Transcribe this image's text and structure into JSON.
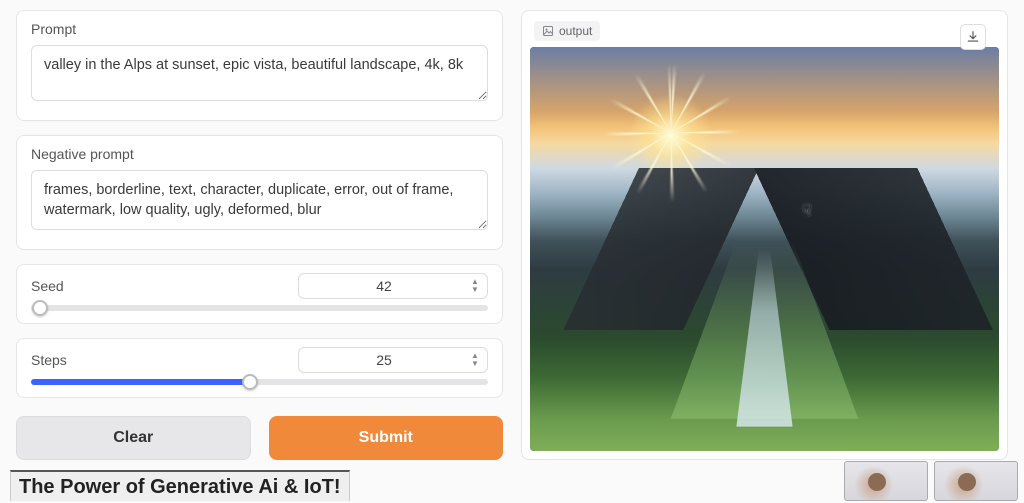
{
  "form": {
    "prompt_label": "Prompt",
    "prompt_value": "valley in the Alps at sunset, epic vista, beautiful landscape, 4k, 8k",
    "neg_label": "Negative prompt",
    "neg_value": "frames, borderline, text, character, duplicate, error, out of frame, watermark, low quality, ugly, deformed, blur",
    "seed": {
      "label": "Seed",
      "value": 42,
      "min": 0,
      "max": 2147483647,
      "fill_percent": 0
    },
    "steps": {
      "label": "Steps",
      "value": 25,
      "min": 1,
      "max": 50,
      "fill_percent": 48
    },
    "clear_label": "Clear",
    "submit_label": "Submit"
  },
  "output": {
    "label": "output",
    "download_tooltip": "Download"
  },
  "overlay": {
    "title_text": "The Power of Generative Ai & IoT!"
  },
  "colors": {
    "accent_button": "#f08a3a",
    "slider_fill": "#3b63ff"
  }
}
